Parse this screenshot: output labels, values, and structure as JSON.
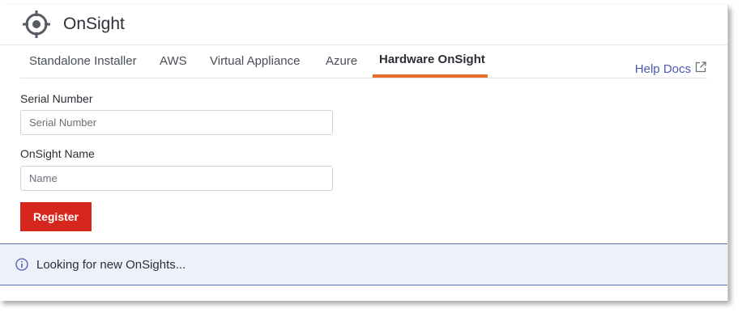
{
  "app": {
    "title": "OnSight"
  },
  "tabs": [
    {
      "label": "Standalone Installer",
      "active": false
    },
    {
      "label": "AWS",
      "active": false
    },
    {
      "label": "Virtual Appliance",
      "active": false
    },
    {
      "label": "Azure",
      "active": false
    },
    {
      "label": "Hardware OnSight",
      "active": true
    }
  ],
  "help": {
    "label": "Help Docs",
    "icon": "external-link-icon"
  },
  "form": {
    "serial_label": "Serial Number",
    "serial_placeholder": "Serial Number",
    "serial_value": "",
    "name_label": "OnSight Name",
    "name_placeholder": "Name",
    "name_value": "",
    "register_label": "Register"
  },
  "status": {
    "text": "Looking for new OnSights...",
    "icon": "info-icon"
  },
  "colors": {
    "accent": "#e8702a",
    "primary_button": "#d7261e",
    "link": "#4a58b0",
    "status_bg": "#eef1fa",
    "status_border": "#6470b6"
  }
}
